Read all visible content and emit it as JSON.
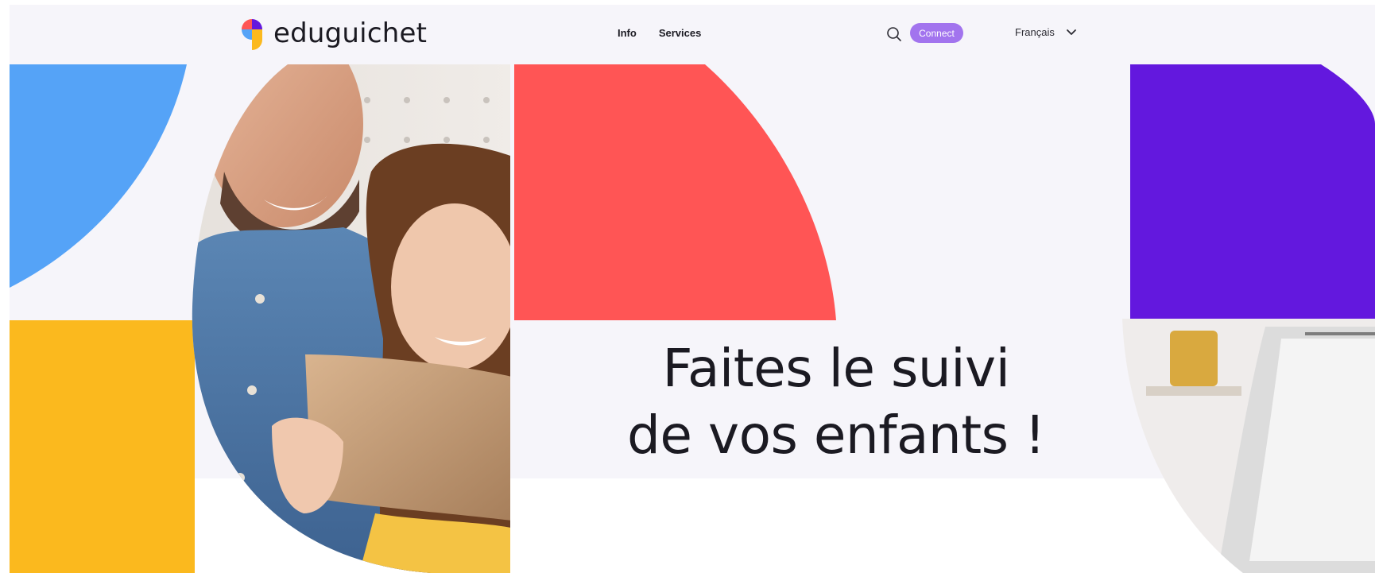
{
  "brand": {
    "name": "eduguichet",
    "colors": {
      "blue": "#55a3f7",
      "red": "#ff5555",
      "purple": "#6318de",
      "yellow": "#fbb91e",
      "connect": "#a274ee",
      "background": "#f6f5fa"
    }
  },
  "nav": {
    "items": [
      {
        "label": "Info"
      },
      {
        "label": "Services"
      }
    ]
  },
  "header": {
    "search_icon": "search-icon",
    "connect_label": "Connect",
    "language": {
      "selected": "Français",
      "icon": "chevron-down-icon"
    }
  },
  "hero": {
    "title_line1": "Faites le suivi",
    "title_line2": "de vos enfants !"
  }
}
